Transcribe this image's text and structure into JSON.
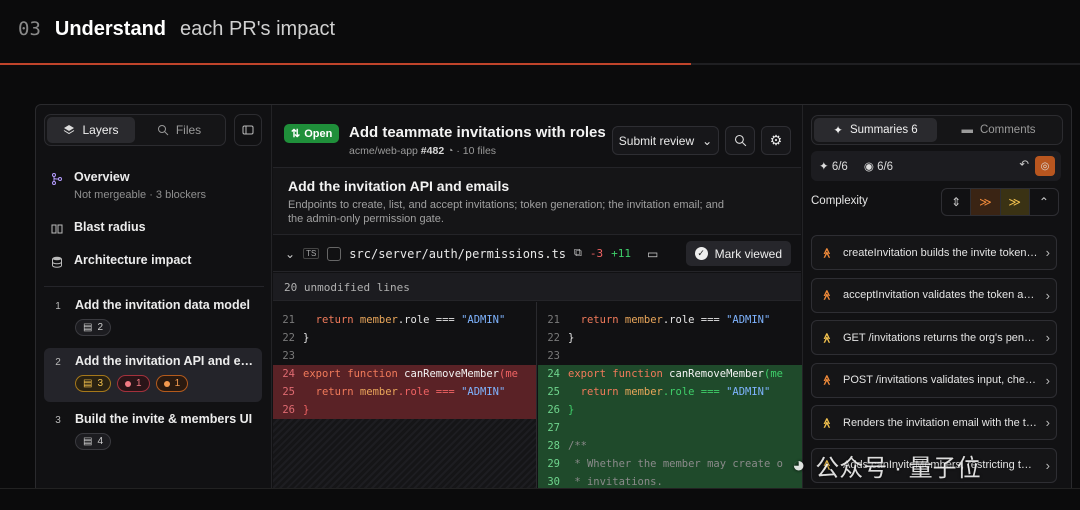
{
  "header": {
    "number": "03",
    "title_bold": "Understand",
    "title_rest": "each PR's impact"
  },
  "progress": {
    "fraction": 0.64
  },
  "left": {
    "tabs": [
      {
        "label": "Layers",
        "icon": "layers-icon",
        "active": true
      },
      {
        "label": "Files",
        "icon": "search-icon",
        "active": false
      }
    ],
    "nav": [
      {
        "label": "Overview",
        "sub": "Not mergeable · 3 blockers",
        "icon": "branch-icon"
      },
      {
        "label": "Blast radius",
        "icon": "book-icon"
      },
      {
        "label": "Architecture impact",
        "icon": "database-icon"
      }
    ],
    "steps": [
      {
        "n": "1",
        "label": "Add the invitation data model",
        "chips": [
          {
            "kind": "file",
            "value": "2"
          }
        ]
      },
      {
        "n": "2",
        "label": "Add the invitation API and emails",
        "chips": [
          {
            "kind": "file-warn",
            "value": "3"
          },
          {
            "kind": "blocker",
            "value": "1"
          },
          {
            "kind": "warning",
            "value": "1"
          }
        ]
      },
      {
        "n": "3",
        "label": "Build the invite & members UI",
        "chips": [
          {
            "kind": "file",
            "value": "4"
          }
        ]
      }
    ]
  },
  "pr": {
    "status": "Open",
    "title": "Add teammate invitations with roles",
    "repo": "acme/web-app",
    "number": "#482",
    "files": "10 files",
    "submit_label": "Submit review",
    "desc_title": "Add the invitation API and emails",
    "desc_body": "Endpoints to create, list, and accept invitations; token generation; the invitation email; and the admin-only permission gate.",
    "file": {
      "lang": "TS",
      "path": "src/server/auth/permissions.ts",
      "deletions": "-3",
      "additions": "+11",
      "mark_label": "Mark viewed"
    },
    "unmodified": "20 unmodified lines"
  },
  "diff": {
    "left": [
      {
        "no": "21",
        "type": "ctx",
        "code": "  return member.role === \"ADMIN\""
      },
      {
        "no": "22",
        "type": "ctx",
        "code": "}"
      },
      {
        "no": "23",
        "type": "ctx",
        "code": ""
      },
      {
        "no": "24",
        "type": "del",
        "code": "export function canRemoveMember(me"
      },
      {
        "no": "25",
        "type": "del",
        "code": "  return member.role === \"ADMIN\""
      },
      {
        "no": "26",
        "type": "del",
        "code": "}"
      }
    ],
    "right": [
      {
        "no": "21",
        "type": "ctx",
        "code": "  return member.role === \"ADMIN\""
      },
      {
        "no": "22",
        "type": "ctx",
        "code": "}"
      },
      {
        "no": "23",
        "type": "ctx",
        "code": ""
      },
      {
        "no": "24",
        "type": "add",
        "code": "export function canRemoveMember(me"
      },
      {
        "no": "25",
        "type": "add",
        "code": "  return member.role === \"ADMIN\""
      },
      {
        "no": "26",
        "type": "add",
        "code": "}"
      },
      {
        "no": "27",
        "type": "add",
        "code": ""
      },
      {
        "no": "28",
        "type": "add",
        "code": "/**"
      },
      {
        "no": "29",
        "type": "add",
        "code": " * Whether the member may create o"
      },
      {
        "no": "30",
        "type": "add",
        "code": " * invitations."
      }
    ]
  },
  "right": {
    "tabs": [
      {
        "label": "Summaries 6",
        "active": true
      },
      {
        "label": "Comments",
        "active": false
      }
    ],
    "counts": {
      "ai": "6/6",
      "viewed": "6/6"
    },
    "complexity_label": "Complexity",
    "summaries": [
      {
        "level": "high",
        "text": "createInvitation builds the invite token and stores it"
      },
      {
        "level": "high",
        "text": "acceptInvitation validates the token and adds the member"
      },
      {
        "level": "medium",
        "text": "GET /invitations returns the org's pending invitations"
      },
      {
        "level": "high",
        "text": "POST /invitations validates input, checks permissions"
      },
      {
        "level": "medium",
        "text": "Renders the invitation email with the team name"
      },
      {
        "level": "medium",
        "text": "Adds canInviteMembers, restricting to admins"
      }
    ]
  },
  "watermark": "公众号 · 量子位",
  "colors": {
    "accent": "#c0442b",
    "open": "#1f8f3a",
    "high": "#f08a3a",
    "medium": "#f2c14e"
  }
}
